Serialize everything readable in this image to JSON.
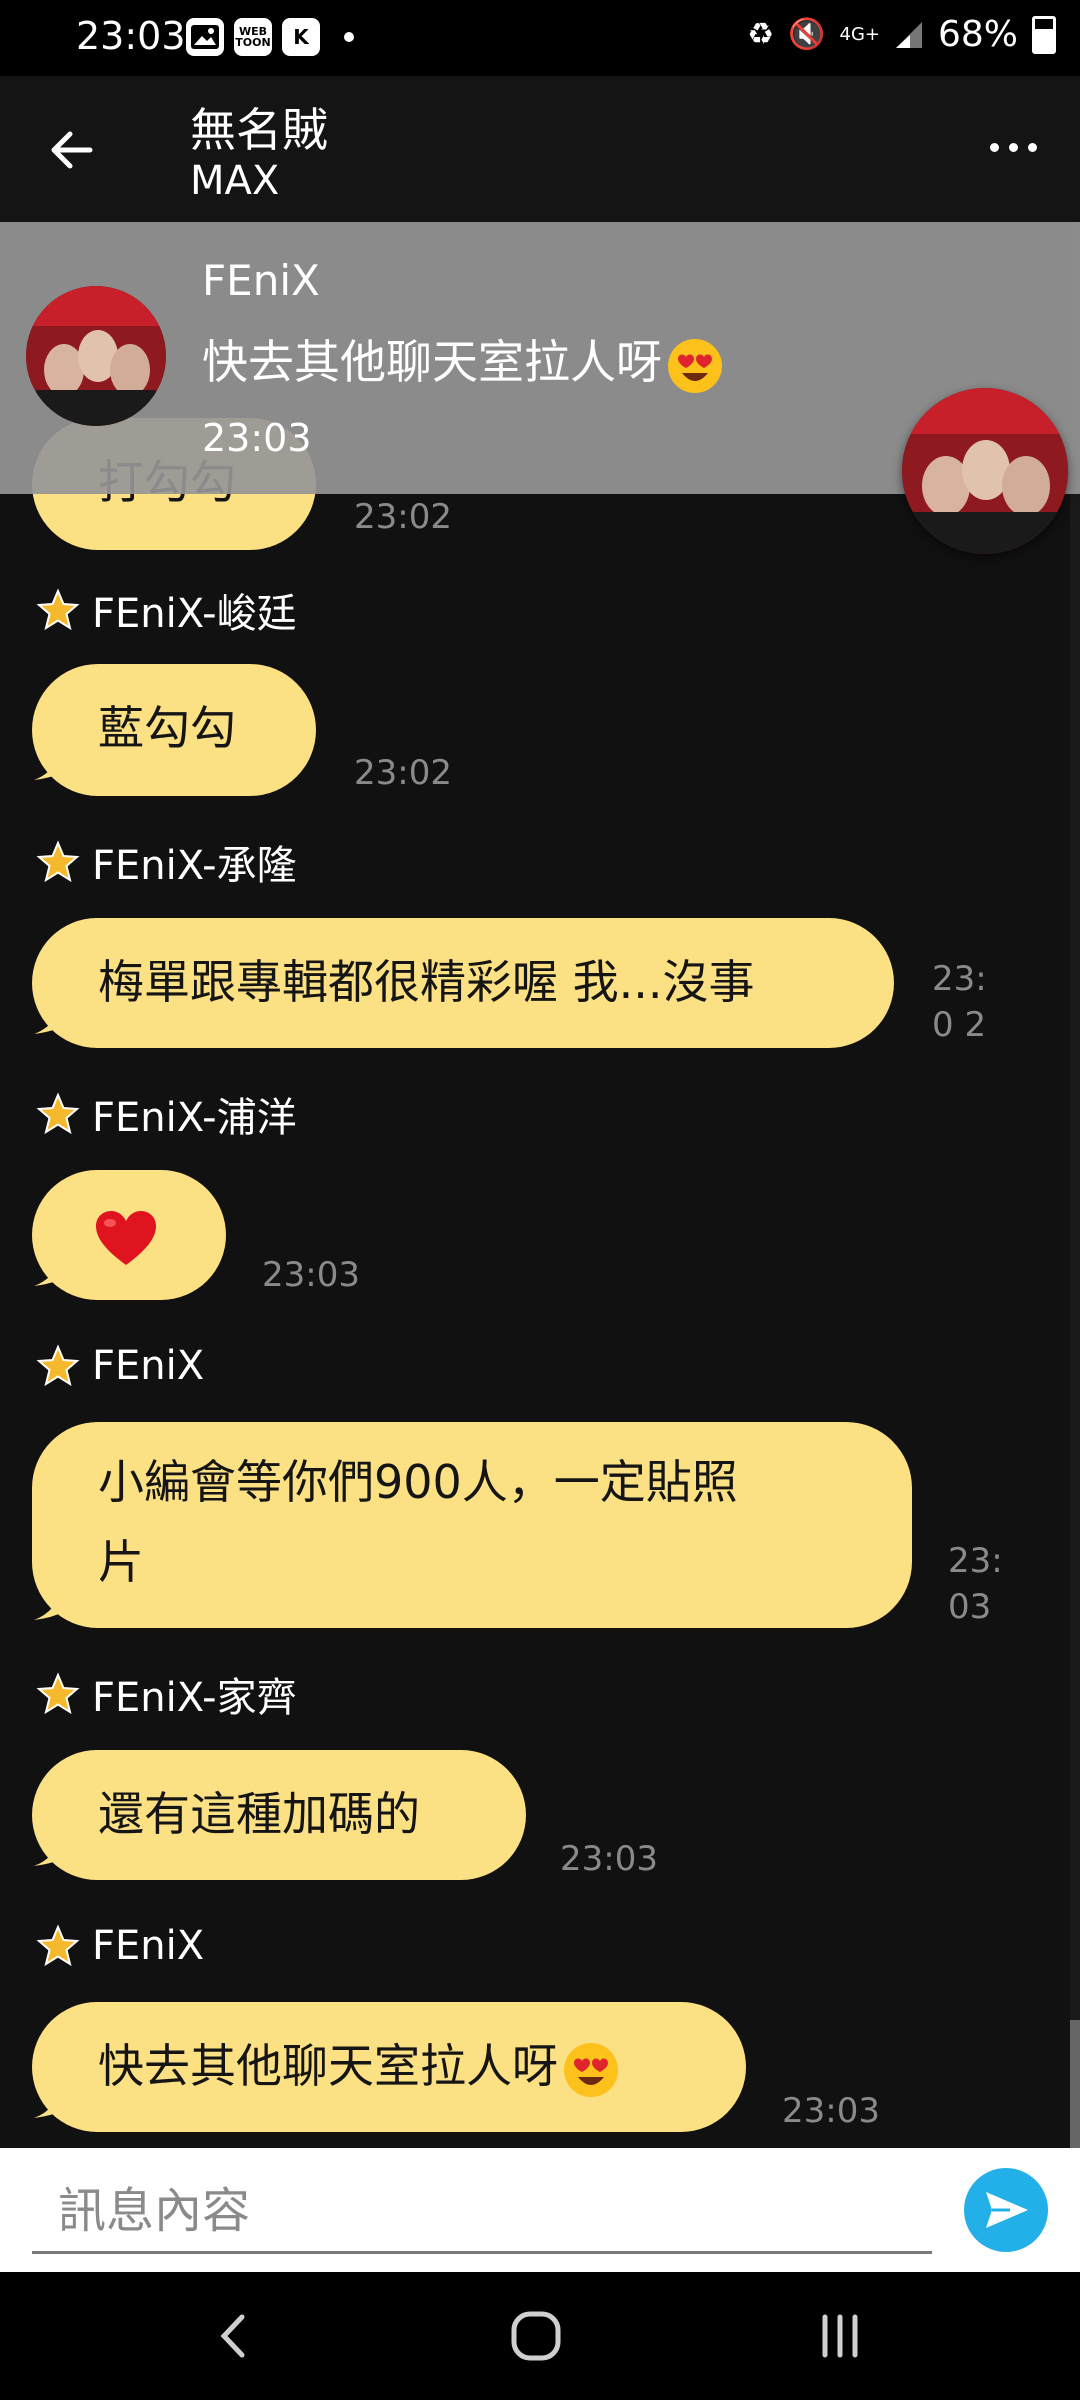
{
  "status_bar": {
    "time": "23:03",
    "left_icons": [
      "image-icon",
      "webtoon-icon",
      "k-app-icon"
    ],
    "left_icon_labels": [
      "WEB TOON",
      "K"
    ],
    "network": "4G+",
    "battery": "68%"
  },
  "header": {
    "title": "無名賊",
    "subtitle": "MAX"
  },
  "notification": {
    "sender": "FEniX",
    "text": "快去其他聊天室拉人呀",
    "emoji": "smiling-face-with-heart-eyes",
    "time": "23:03"
  },
  "messages": [
    {
      "sender": "",
      "text": "打勾勾",
      "time": "23:02"
    },
    {
      "sender": "FEniX-峻廷",
      "text": "藍勾勾",
      "time": "23:02"
    },
    {
      "sender": "FEniX-承隆",
      "text": "梅單跟專輯都很精彩喔 我...沒事",
      "time": "23:0 2"
    },
    {
      "sender": "FEniX-浦洋",
      "text": "",
      "emoji": "red-heart",
      "time": "23:03"
    },
    {
      "sender": "FEniX",
      "line1": "小編會等你們900人，一定貼照",
      "line2": "片",
      "time_line1": "23:",
      "time_line2": "03"
    },
    {
      "sender": "FEniX-家齊",
      "text": "還有這種加碼的",
      "time": "23:03"
    },
    {
      "sender": "FEniX",
      "text": "快去其他聊天室拉人呀",
      "emoji": "smiling-face-with-heart-eyes",
      "time": "23:03"
    }
  ],
  "input": {
    "placeholder": "訊息內容"
  },
  "colors": {
    "bubble": "#fbe084",
    "background": "#111111",
    "send_button": "#23b0e8",
    "star": "#f5b92e"
  }
}
